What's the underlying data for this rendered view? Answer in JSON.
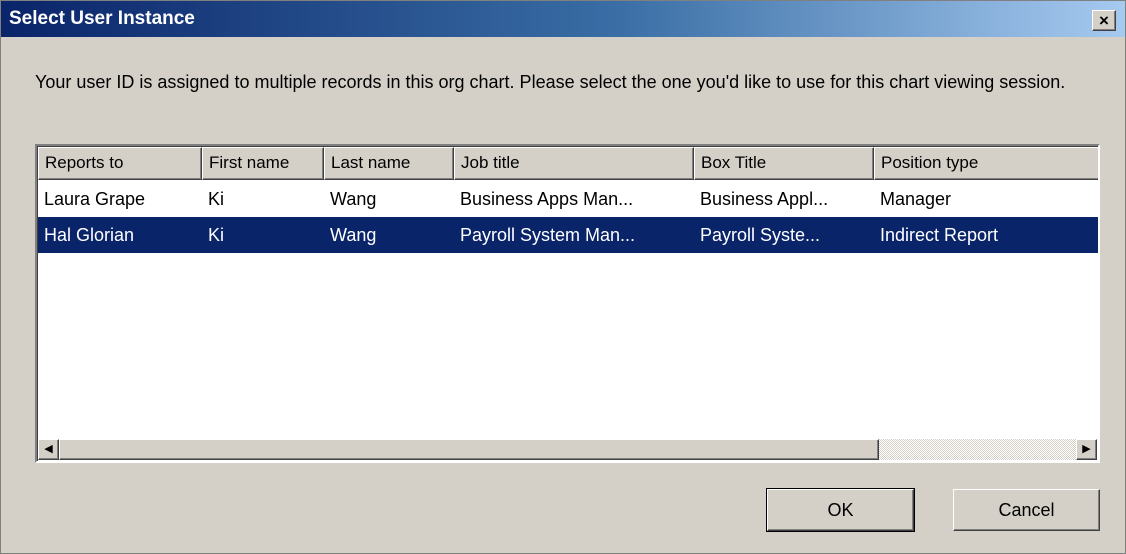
{
  "window": {
    "title": "Select User Instance",
    "close_label": "×"
  },
  "message": "Your user ID is assigned to multiple records in this org chart. Please select the one you'd like to use for this chart viewing session.",
  "table": {
    "columns": [
      "Reports to",
      "First name",
      "Last name",
      "Job title",
      "Box Title",
      "Position type"
    ],
    "rows": [
      {
        "cells": [
          "Laura Grape",
          "Ki",
          "Wang",
          "Business Apps Man...",
          "Business Appl...",
          "Manager"
        ],
        "selected": false
      },
      {
        "cells": [
          "Hal Glorian",
          "Ki",
          "Wang",
          "Payroll System Man...",
          "Payroll Syste...",
          "Indirect Report"
        ],
        "selected": true
      }
    ]
  },
  "scrollbar": {
    "left_arrow": "◀",
    "right_arrow": "▶"
  },
  "buttons": {
    "ok_label": "OK",
    "cancel_label": "Cancel"
  },
  "colors": {
    "selection": "#0a246a",
    "dialog_face": "#d4d0c8"
  }
}
